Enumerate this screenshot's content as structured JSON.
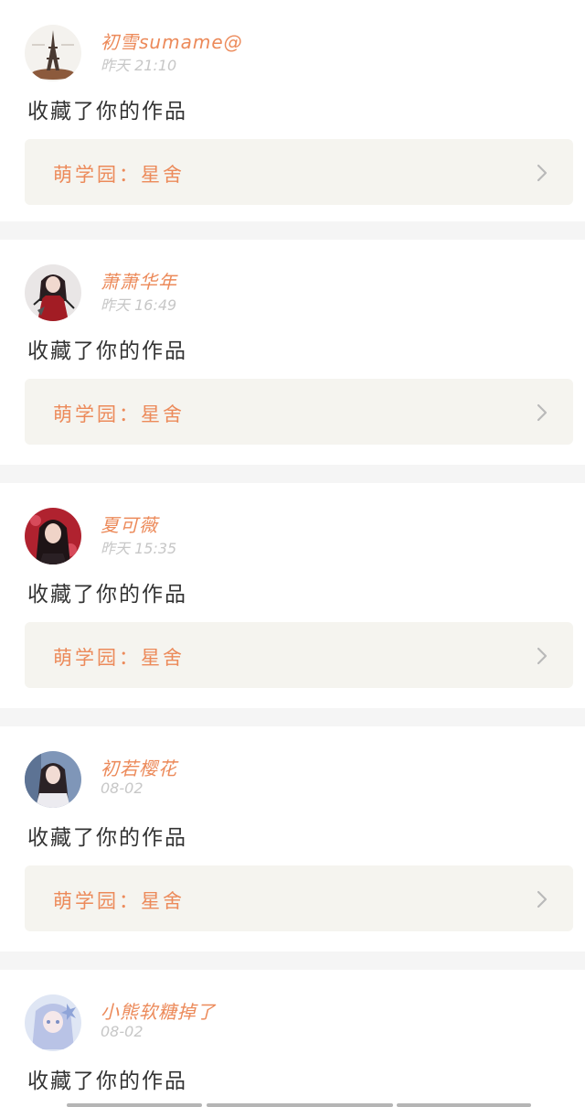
{
  "feed": {
    "items": [
      {
        "username": "初雪sumame@",
        "time": "昨天 21:10",
        "action": "收藏了你的作品",
        "work_label": "萌学园：星舍",
        "avatar": "eiffel-tower-avatar"
      },
      {
        "username": "萧萧华年",
        "time": "昨天 16:49",
        "action": "收藏了你的作品",
        "work_label": "萌学园：星舍",
        "avatar": "anime-warrior-avatar"
      },
      {
        "username": "夏可薇",
        "time": "昨天 15:35",
        "action": "收藏了你的作品",
        "work_label": "萌学园：星舍",
        "avatar": "girl-red-background-avatar"
      },
      {
        "username": "初若樱花",
        "time": "08-02",
        "action": "收藏了你的作品",
        "work_label": "萌学园：星舍",
        "avatar": "girl-portrait-avatar"
      },
      {
        "username": "小熊软糖掉了",
        "time": "08-02",
        "action": "收藏了你的作品",
        "avatar": "anime-girl-blue-avatar"
      }
    ]
  },
  "colors": {
    "username": "#ec8a5a",
    "timestamp": "#c7c7c7",
    "action_text": "#333333",
    "work_card_bg": "#f5f4ef",
    "separator_bg": "#f5f5f5"
  }
}
